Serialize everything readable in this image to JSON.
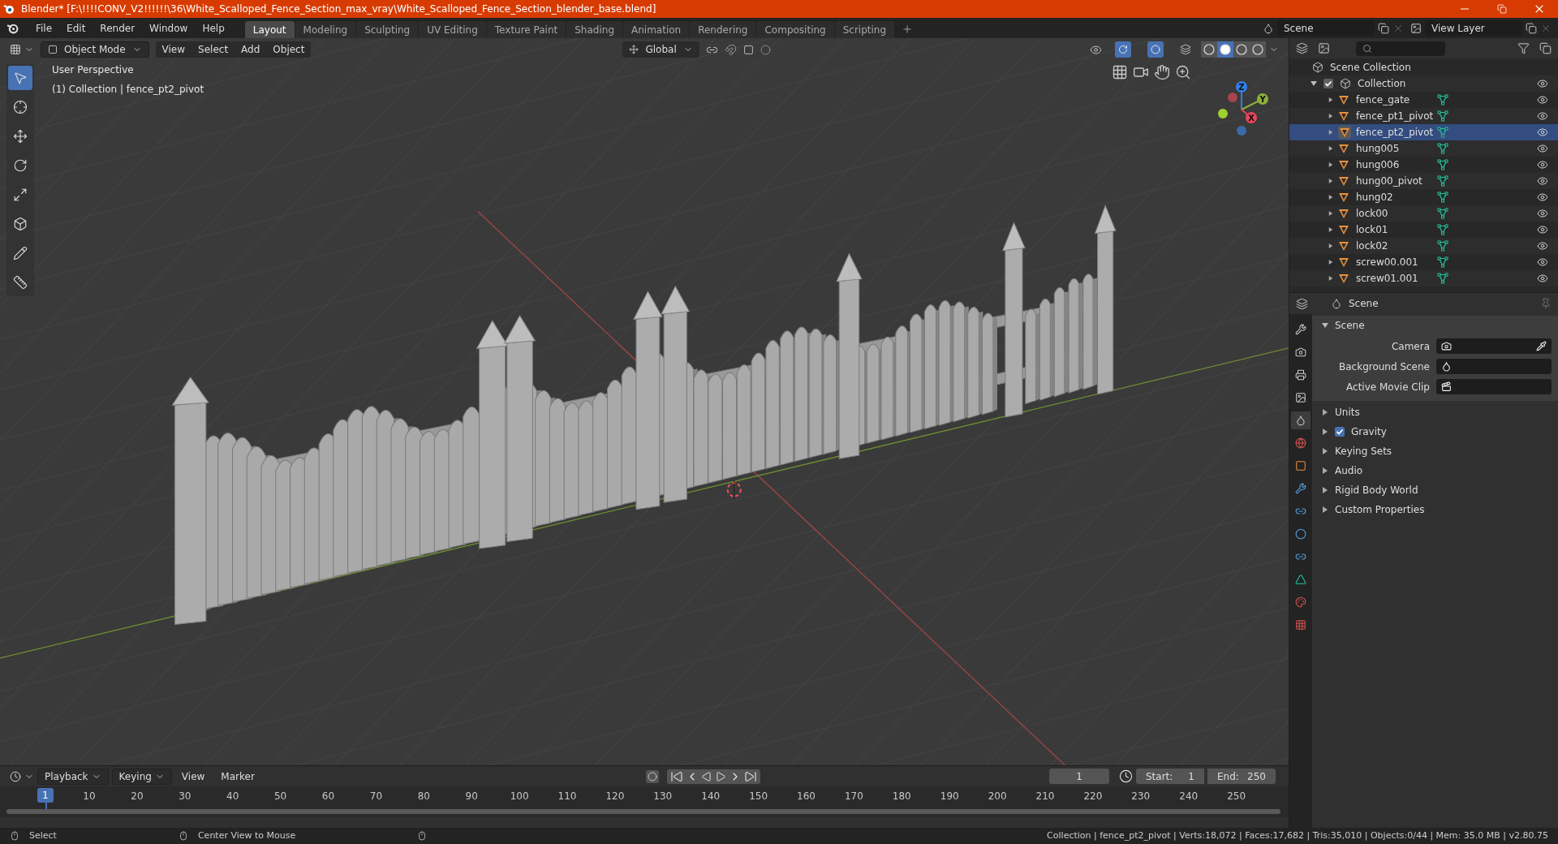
{
  "window": {
    "title": "Blender* [F:\\!!!!CONV_V2!!!!!!\\36\\White_Scalloped_Fence_Section_max_vray\\White_Scalloped_Fence_Section_blender_base.blend]"
  },
  "menu": [
    "File",
    "Edit",
    "Render",
    "Window",
    "Help"
  ],
  "workspaces": [
    {
      "label": "Layout",
      "selected": true
    },
    {
      "label": "Modeling",
      "selected": false
    },
    {
      "label": "Sculpting",
      "selected": false
    },
    {
      "label": "UV Editing",
      "selected": false
    },
    {
      "label": "Texture Paint",
      "selected": false
    },
    {
      "label": "Shading",
      "selected": false
    },
    {
      "label": "Animation",
      "selected": false
    },
    {
      "label": "Rendering",
      "selected": false
    },
    {
      "label": "Compositing",
      "selected": false
    },
    {
      "label": "Scripting",
      "selected": false
    }
  ],
  "scene_field": {
    "value": "Scene"
  },
  "view_layer_field": {
    "value": "View Layer"
  },
  "viewport": {
    "mode": "Object Mode",
    "menus": [
      "View",
      "Select",
      "Add",
      "Object"
    ],
    "orientation": "Global",
    "shading": [
      {
        "selected": false
      },
      {
        "selected": true
      },
      {
        "selected": false
      },
      {
        "selected": false
      }
    ],
    "overlay_lines": [
      "User Perspective",
      "(1) Collection | fence_pt2_pivot"
    ],
    "gizmo_axes": [
      "Z",
      "Y",
      "X"
    ],
    "tools": [
      {
        "selected": true
      },
      {
        "selected": false
      },
      {
        "selected": false
      },
      {
        "selected": false
      },
      {
        "selected": false
      },
      {
        "selected": false
      },
      {
        "selected": false
      },
      {
        "selected": false
      }
    ]
  },
  "outliner": {
    "root": "Scene Collection",
    "collection": {
      "name": "Collection",
      "checked": true,
      "expanded": true,
      "children": [
        {
          "name": "fence_gate",
          "selected": false
        },
        {
          "name": "fence_pt1_pivot",
          "selected": false
        },
        {
          "name": "fence_pt2_pivot",
          "selected": true
        },
        {
          "name": "hung005",
          "selected": false
        },
        {
          "name": "hung006",
          "selected": false
        },
        {
          "name": "hung00_pivot",
          "selected": false
        },
        {
          "name": "hung02",
          "selected": false
        },
        {
          "name": "lock00",
          "selected": false
        },
        {
          "name": "lock01",
          "selected": false
        },
        {
          "name": "lock02",
          "selected": false
        },
        {
          "name": "screw00.001",
          "selected": false
        },
        {
          "name": "screw01.001",
          "selected": false
        }
      ]
    }
  },
  "properties": {
    "context": "Scene",
    "tabs": [
      {
        "selected": false
      },
      {
        "selected": false
      },
      {
        "selected": false
      },
      {
        "selected": false
      },
      {
        "selected": true
      },
      {
        "selected": false
      },
      {
        "selected": false
      },
      {
        "selected": false
      },
      {
        "selected": false
      },
      {
        "selected": false
      },
      {
        "selected": false
      },
      {
        "selected": false
      },
      {
        "selected": false
      },
      {
        "selected": false
      }
    ],
    "panel": {
      "title": "Scene",
      "expanded": true,
      "fields": [
        {
          "label": "Camera"
        },
        {
          "label": "Background Scene"
        },
        {
          "label": "Active Movie Clip"
        }
      ]
    },
    "subpanels": [
      {
        "title": "Units",
        "kind": "plain"
      },
      {
        "title": "Gravity",
        "kind": "checkbox",
        "checked": true
      },
      {
        "title": "Keying Sets",
        "kind": "plain"
      },
      {
        "title": "Audio",
        "kind": "plain"
      },
      {
        "title": "Rigid Body World",
        "kind": "plain"
      },
      {
        "title": "Custom Properties",
        "kind": "plain"
      }
    ]
  },
  "timeline": {
    "menus": [
      "Playback",
      "Keying",
      "View",
      "Marker"
    ],
    "current_frame": "1",
    "start_label": "Start:",
    "start": "1",
    "end_label": "End:",
    "end": "250",
    "playhead": "1",
    "ruler": [
      "10",
      "20",
      "30",
      "40",
      "50",
      "60",
      "70",
      "80",
      "90",
      "100",
      "110",
      "120",
      "130",
      "140",
      "150",
      "160",
      "170",
      "180",
      "190",
      "200",
      "210",
      "220",
      "230",
      "240",
      "250"
    ]
  },
  "status_bar": {
    "hints": [
      "Select",
      "Center View to Mouse"
    ],
    "stats": "Collection | fence_pt2_pivot | Verts:18,072 | Faces:17,682 | Tris:35,010 | Objects:0/44 | Mem: 35.0 MB | v2.80.75"
  }
}
